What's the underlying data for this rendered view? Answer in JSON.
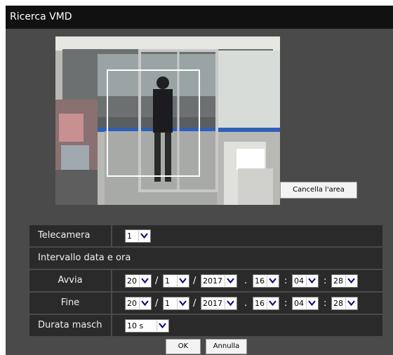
{
  "window": {
    "title": "Ricerca VMD"
  },
  "video": {
    "clear_area_label": "Cancella l'area"
  },
  "form": {
    "camera": {
      "label": "Telecamera",
      "value": "1"
    },
    "date_time_section": "Intervallo data e ora",
    "start": {
      "label": "Avvia",
      "day": "20",
      "month": "1",
      "year": "2017",
      "hour": "16",
      "minute": "04",
      "second": "28"
    },
    "end": {
      "label": "Fine",
      "day": "20",
      "month": "1",
      "year": "2017",
      "hour": "16",
      "minute": "04",
      "second": "28"
    },
    "mask_duration": {
      "label": "Durata masch",
      "value": "10 s"
    },
    "separators": {
      "date": "/",
      "datetime": ".",
      "time": ":"
    }
  },
  "buttons": {
    "ok": "OK",
    "cancel": "Annulla"
  }
}
